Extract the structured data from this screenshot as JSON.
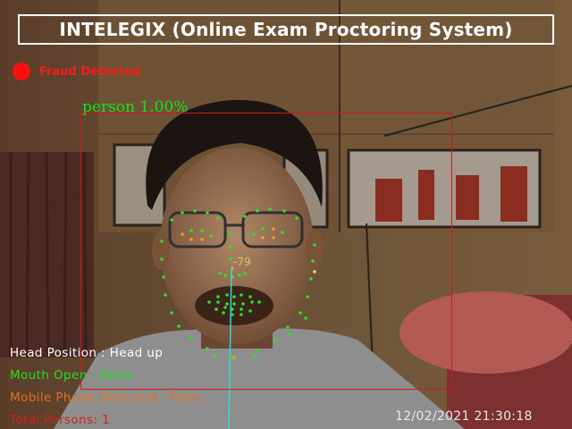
{
  "app": {
    "title": "INTELEGIX (Online Exam Proctoring System)"
  },
  "alert": {
    "text": "Fraud Detected",
    "color": "#ff1a1a"
  },
  "detection": {
    "label": "person 1.00%",
    "box_color": "#d01818",
    "label_color": "#19e019",
    "head_angle": "-79"
  },
  "status": {
    "head_position": "Head Position : Head up",
    "mouth_open": "Mouth Open : False",
    "mobile_phone": "Mobile Phone Detected : False",
    "total_persons": "Total Persons: 1",
    "colors": {
      "head_position": "#ffffff",
      "mouth_open": "#22dd22",
      "mobile_phone": "#e07020",
      "total_persons": "#d02020"
    }
  },
  "timestamp": "12/02/2021 21:30:18",
  "icons": [
    "alert-dot-icon"
  ]
}
